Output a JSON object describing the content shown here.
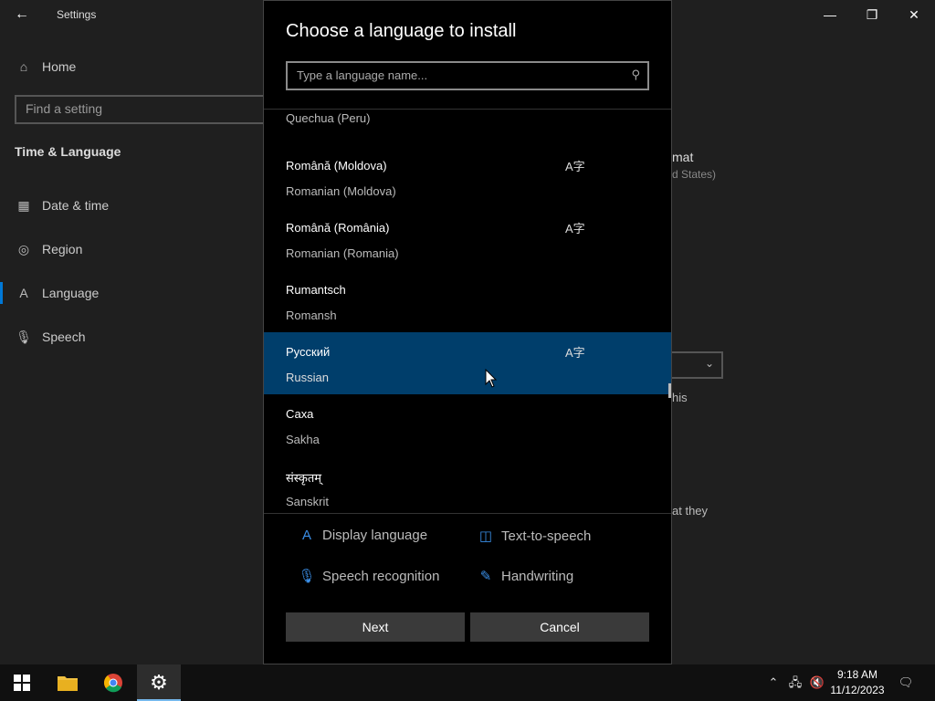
{
  "window": {
    "title": "Settings",
    "back_icon": "←",
    "minimize_icon": "—",
    "restore_icon": "❐",
    "close_icon": "✕"
  },
  "sidebar": {
    "home_label": "Home",
    "find_placeholder": "Find a setting",
    "section_title": "Time & Language",
    "items": [
      {
        "label": "Date & time",
        "icon": "▦"
      },
      {
        "label": "Region",
        "icon": "◎"
      },
      {
        "label": "Language",
        "icon": "A"
      },
      {
        "label": "Speech",
        "icon": "🎙"
      }
    ]
  },
  "background_fragments": {
    "format": "mat",
    "format_sub": "d States)",
    "line1": "his",
    "line2": "at they"
  },
  "dialog": {
    "title": "Choose a language to install",
    "search_placeholder": "Type a language name...",
    "languages": [
      {
        "native": "",
        "english": "Quechua (Peru)",
        "has_display": true
      },
      {
        "native": "Română (Moldova)",
        "english": "Romanian (Moldova)",
        "has_display": true
      },
      {
        "native": "Română (România)",
        "english": "Romanian (Romania)",
        "has_display": true
      },
      {
        "native": "Rumantsch",
        "english": "Romansh",
        "has_display": false
      },
      {
        "native": "Русский",
        "english": "Russian",
        "has_display": true,
        "selected": true
      },
      {
        "native": "Саха",
        "english": "Sakha",
        "has_display": false
      },
      {
        "native": "संस्कृतम्",
        "english": "Sanskrit",
        "has_display": false
      }
    ],
    "features": [
      {
        "label": "Display language",
        "icon": "A"
      },
      {
        "label": "Text-to-speech",
        "icon": "◫"
      },
      {
        "label": "Speech recognition",
        "icon": "🎙"
      },
      {
        "label": "Handwriting",
        "icon": "✎"
      }
    ],
    "next_label": "Next",
    "cancel_label": "Cancel"
  },
  "taskbar": {
    "time": "9:18 AM",
    "date": "11/12/2023"
  }
}
